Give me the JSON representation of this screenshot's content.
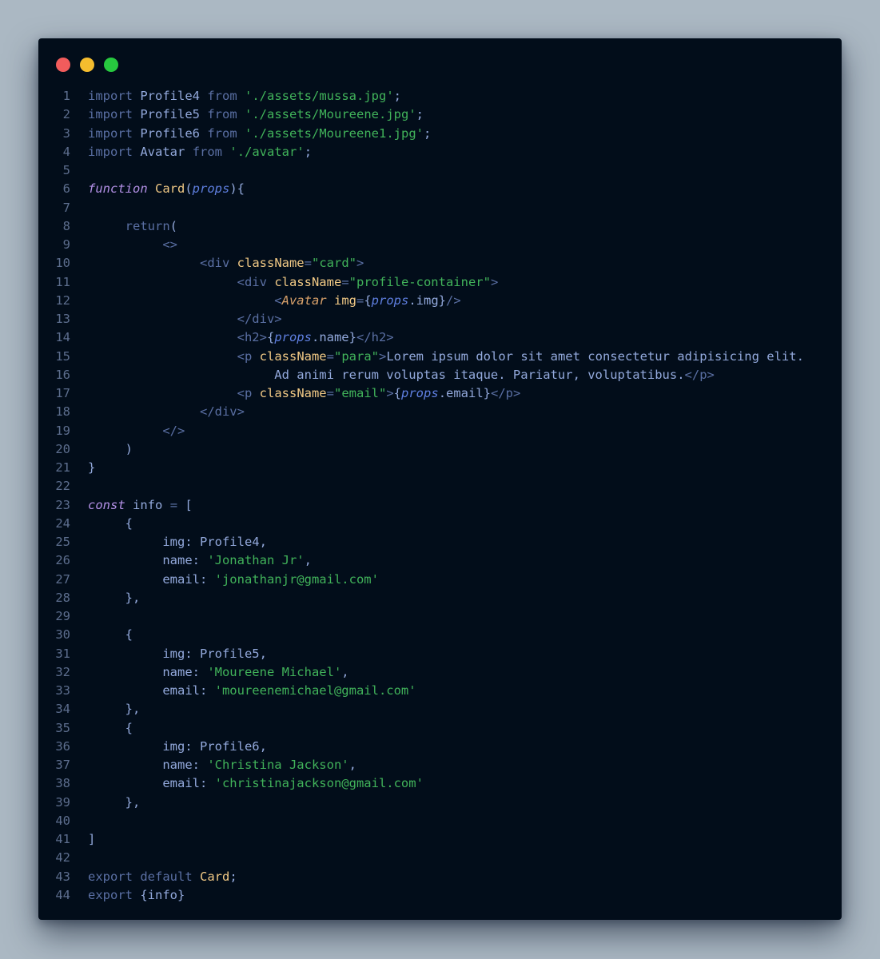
{
  "window": {
    "traffic_lights": [
      {
        "name": "close-dot",
        "color": "#f25c5c"
      },
      {
        "name": "minimize-dot",
        "color": "#f5bd2e"
      },
      {
        "name": "maximize-dot",
        "color": "#27c93f"
      }
    ]
  },
  "code": {
    "lines": [
      {
        "n": "1",
        "tokens": [
          [
            "kw",
            "import"
          ],
          [
            "p",
            " "
          ],
          [
            "id",
            "Profile4"
          ],
          [
            "p",
            " "
          ],
          [
            "kw",
            "from"
          ],
          [
            "p",
            " "
          ],
          [
            "str",
            "'./assets/mussa.jpg'"
          ],
          [
            "p",
            ";"
          ]
        ]
      },
      {
        "n": "2",
        "tokens": [
          [
            "kw",
            "import"
          ],
          [
            "p",
            " "
          ],
          [
            "id",
            "Profile5"
          ],
          [
            "p",
            " "
          ],
          [
            "kw",
            "from"
          ],
          [
            "p",
            " "
          ],
          [
            "str",
            "'./assets/Moureene.jpg'"
          ],
          [
            "p",
            ";"
          ]
        ]
      },
      {
        "n": "3",
        "tokens": [
          [
            "kw",
            "import"
          ],
          [
            "p",
            " "
          ],
          [
            "id",
            "Profile6"
          ],
          [
            "p",
            " "
          ],
          [
            "kw",
            "from"
          ],
          [
            "p",
            " "
          ],
          [
            "str",
            "'./assets/Moureene1.jpg'"
          ],
          [
            "p",
            ";"
          ]
        ]
      },
      {
        "n": "4",
        "tokens": [
          [
            "kw",
            "import"
          ],
          [
            "p",
            " "
          ],
          [
            "id",
            "Avatar"
          ],
          [
            "p",
            " "
          ],
          [
            "kw",
            "from"
          ],
          [
            "p",
            " "
          ],
          [
            "str",
            "'./avatar'"
          ],
          [
            "p",
            ";"
          ]
        ]
      },
      {
        "n": "5",
        "tokens": []
      },
      {
        "n": "6",
        "tokens": [
          [
            "kwi",
            "function"
          ],
          [
            "p",
            " "
          ],
          [
            "fn",
            "Card"
          ],
          [
            "p",
            "("
          ],
          [
            "par",
            "props"
          ],
          [
            "p",
            "){"
          ]
        ]
      },
      {
        "n": "7",
        "tokens": []
      },
      {
        "n": "8",
        "tokens": [
          [
            "p",
            "     "
          ],
          [
            "kw",
            "return"
          ],
          [
            "p",
            "("
          ]
        ]
      },
      {
        "n": "9",
        "tokens": [
          [
            "p",
            "          "
          ],
          [
            "tag",
            "<>"
          ]
        ]
      },
      {
        "n": "10",
        "tokens": [
          [
            "p",
            "               "
          ],
          [
            "tag",
            "<div"
          ],
          [
            "p",
            " "
          ],
          [
            "attr",
            "className"
          ],
          [
            "op",
            "="
          ],
          [
            "str",
            "\"card\""
          ],
          [
            "tag",
            ">"
          ]
        ]
      },
      {
        "n": "11",
        "tokens": [
          [
            "p",
            "                    "
          ],
          [
            "tag",
            "<div"
          ],
          [
            "p",
            " "
          ],
          [
            "attr",
            "className"
          ],
          [
            "op",
            "="
          ],
          [
            "str",
            "\"profile-container\""
          ],
          [
            "tag",
            ">"
          ]
        ]
      },
      {
        "n": "12",
        "tokens": [
          [
            "p",
            "                         "
          ],
          [
            "tag",
            "<"
          ],
          [
            "comp",
            "Avatar"
          ],
          [
            "p",
            " "
          ],
          [
            "attr",
            "img"
          ],
          [
            "op",
            "="
          ],
          [
            "p",
            "{"
          ],
          [
            "par",
            "props"
          ],
          [
            "p",
            ".img}"
          ],
          [
            "tag",
            "/>"
          ]
        ]
      },
      {
        "n": "13",
        "tokens": [
          [
            "p",
            "                    "
          ],
          [
            "tag",
            "</div>"
          ]
        ]
      },
      {
        "n": "14",
        "tokens": [
          [
            "p",
            "                    "
          ],
          [
            "tag",
            "<h2>"
          ],
          [
            "p",
            "{"
          ],
          [
            "par",
            "props"
          ],
          [
            "p",
            ".name}"
          ],
          [
            "tag",
            "</h2>"
          ]
        ]
      },
      {
        "n": "15",
        "tokens": [
          [
            "p",
            "                    "
          ],
          [
            "tag",
            "<p"
          ],
          [
            "p",
            " "
          ],
          [
            "attr",
            "className"
          ],
          [
            "op",
            "="
          ],
          [
            "str",
            "\"para\""
          ],
          [
            "tag",
            ">"
          ],
          [
            "p",
            "Lorem ipsum dolor sit amet consectetur adipisicing elit."
          ]
        ]
      },
      {
        "n": "16",
        "tokens": [
          [
            "p",
            "                         Ad animi rerum voluptas itaque. Pariatur, voluptatibus."
          ],
          [
            "tag",
            "</p>"
          ]
        ]
      },
      {
        "n": "17",
        "tokens": [
          [
            "p",
            "                    "
          ],
          [
            "tag",
            "<p"
          ],
          [
            "p",
            " "
          ],
          [
            "attr",
            "className"
          ],
          [
            "op",
            "="
          ],
          [
            "str",
            "\"email\""
          ],
          [
            "tag",
            ">"
          ],
          [
            "p",
            "{"
          ],
          [
            "par",
            "props"
          ],
          [
            "p",
            ".email}"
          ],
          [
            "tag",
            "</p>"
          ]
        ]
      },
      {
        "n": "18",
        "tokens": [
          [
            "p",
            "               "
          ],
          [
            "tag",
            "</div>"
          ]
        ]
      },
      {
        "n": "19",
        "tokens": [
          [
            "p",
            "          "
          ],
          [
            "tag",
            "</>"
          ]
        ]
      },
      {
        "n": "20",
        "tokens": [
          [
            "p",
            "     )"
          ]
        ]
      },
      {
        "n": "21",
        "tokens": [
          [
            "p",
            "}"
          ]
        ]
      },
      {
        "n": "22",
        "tokens": []
      },
      {
        "n": "23",
        "tokens": [
          [
            "kwi",
            "const"
          ],
          [
            "p",
            " "
          ],
          [
            "id",
            "info"
          ],
          [
            "p",
            " "
          ],
          [
            "op",
            "="
          ],
          [
            "p",
            " ["
          ]
        ]
      },
      {
        "n": "24",
        "tokens": [
          [
            "p",
            "     {"
          ]
        ]
      },
      {
        "n": "25",
        "tokens": [
          [
            "p",
            "          img: Profile4,"
          ]
        ]
      },
      {
        "n": "26",
        "tokens": [
          [
            "p",
            "          name: "
          ],
          [
            "str",
            "'Jonathan Jr'"
          ],
          [
            "p",
            ","
          ]
        ]
      },
      {
        "n": "27",
        "tokens": [
          [
            "p",
            "          email: "
          ],
          [
            "str",
            "'jonathanjr@gmail.com'"
          ]
        ]
      },
      {
        "n": "28",
        "tokens": [
          [
            "p",
            "     },"
          ]
        ]
      },
      {
        "n": "29",
        "tokens": []
      },
      {
        "n": "30",
        "tokens": [
          [
            "p",
            "     {"
          ]
        ]
      },
      {
        "n": "31",
        "tokens": [
          [
            "p",
            "          img: Profile5,"
          ]
        ]
      },
      {
        "n": "32",
        "tokens": [
          [
            "p",
            "          name: "
          ],
          [
            "str",
            "'Moureene Michael'"
          ],
          [
            "p",
            ","
          ]
        ]
      },
      {
        "n": "33",
        "tokens": [
          [
            "p",
            "          email: "
          ],
          [
            "str",
            "'moureenemichael@gmail.com'"
          ]
        ]
      },
      {
        "n": "34",
        "tokens": [
          [
            "p",
            "     },"
          ]
        ]
      },
      {
        "n": "35",
        "tokens": [
          [
            "p",
            "     {"
          ]
        ]
      },
      {
        "n": "36",
        "tokens": [
          [
            "p",
            "          img: Profile6,"
          ]
        ]
      },
      {
        "n": "37",
        "tokens": [
          [
            "p",
            "          name: "
          ],
          [
            "str",
            "'Christina Jackson'"
          ],
          [
            "p",
            ","
          ]
        ]
      },
      {
        "n": "38",
        "tokens": [
          [
            "p",
            "          email: "
          ],
          [
            "str",
            "'christinajackson@gmail.com'"
          ]
        ]
      },
      {
        "n": "39",
        "tokens": [
          [
            "p",
            "     },"
          ]
        ]
      },
      {
        "n": "40",
        "tokens": []
      },
      {
        "n": "41",
        "tokens": [
          [
            "p",
            "]"
          ]
        ]
      },
      {
        "n": "42",
        "tokens": []
      },
      {
        "n": "43",
        "tokens": [
          [
            "kw",
            "export"
          ],
          [
            "p",
            " "
          ],
          [
            "kw",
            "default"
          ],
          [
            "p",
            " "
          ],
          [
            "fn",
            "Card"
          ],
          [
            "p",
            ";"
          ]
        ]
      },
      {
        "n": "44",
        "tokens": [
          [
            "kw",
            "export"
          ],
          [
            "p",
            " {info}"
          ]
        ]
      }
    ]
  },
  "colors": {
    "page_background": "#abb8c3",
    "editor_background": "#020d1a",
    "keyword": "#5a6fa3",
    "keyword_italic": "#b390e6",
    "identifier": "#93a9dc",
    "string": "#41b35a",
    "function_name": "#f1c985",
    "parameter": "#5f7fe0",
    "component": "#d9a16a",
    "line_number": "#5d6e8e"
  }
}
